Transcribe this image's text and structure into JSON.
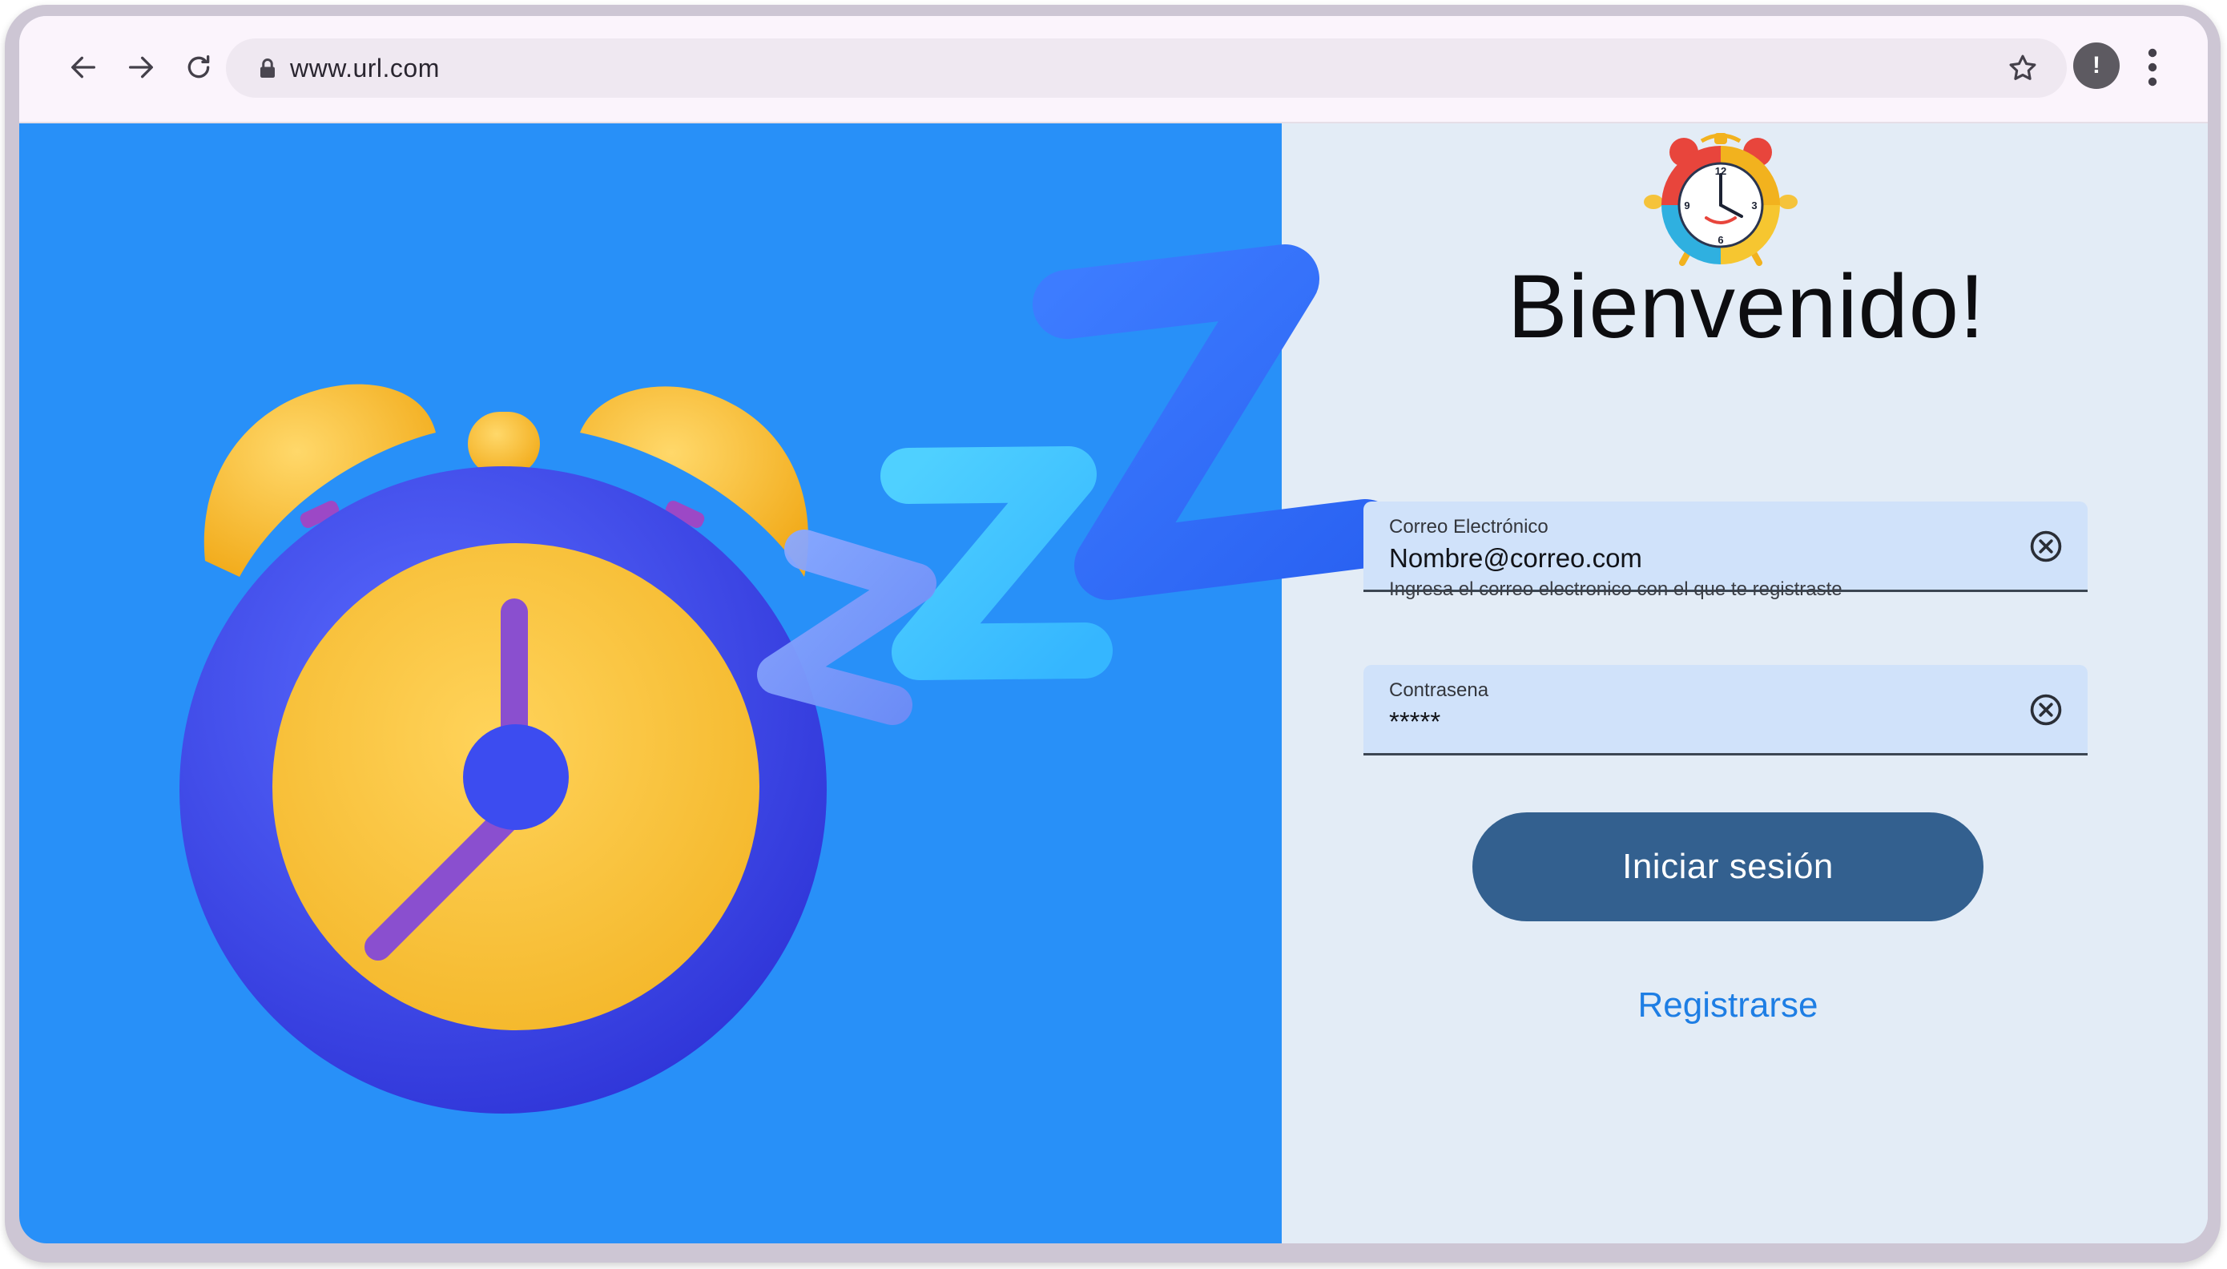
{
  "browser": {
    "url": "www.url.com",
    "profile_initial": "!"
  },
  "icons": {
    "back": "arrow-left-icon",
    "forward": "arrow-right-icon",
    "reload": "reload-icon",
    "lock": "lock-icon",
    "bookmark": "star-icon",
    "menu": "vertical-dots-icon",
    "clear": "circle-x-icon"
  },
  "colors": {
    "hero_background": "#2890f8",
    "form_background": "#e3ecf6",
    "field_fill": "#d0e2fa",
    "primary_button": "#33608f",
    "link": "#1e7ee4"
  },
  "login": {
    "title": "Bienvenido!",
    "email": {
      "label": "Correo Electrónico",
      "value": "Nombre@correo.com",
      "helper": "Ingresa el correo electronico con el que te registraste"
    },
    "password": {
      "label": "Contrasena",
      "value": "*****"
    },
    "submit_label": "Iniciar sesión",
    "register_label": "Registrarse"
  }
}
